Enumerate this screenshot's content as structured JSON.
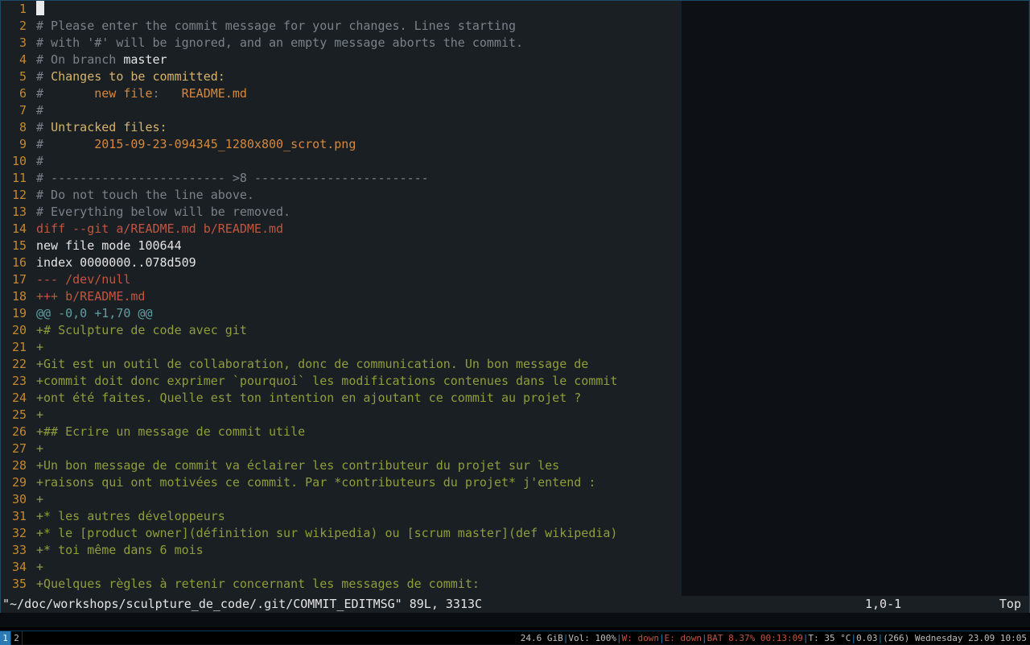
{
  "lines": [
    {
      "n": 1,
      "segs": [
        {
          "cursor": true
        }
      ]
    },
    {
      "n": 2,
      "segs": [
        {
          "t": "# Please enter the commit message for your changes. Lines starting",
          "c": "c-comment"
        }
      ]
    },
    {
      "n": 3,
      "segs": [
        {
          "t": "# with '#' will be ignored, and an empty message aborts the commit.",
          "c": "c-comment"
        }
      ]
    },
    {
      "n": 4,
      "segs": [
        {
          "t": "# On branch ",
          "c": "c-comment"
        },
        {
          "t": "master",
          "c": "c-white"
        }
      ]
    },
    {
      "n": 5,
      "segs": [
        {
          "t": "# ",
          "c": "c-comment"
        },
        {
          "t": "Changes to be committed:",
          "c": "c-yellow"
        }
      ]
    },
    {
      "n": 6,
      "segs": [
        {
          "t": "#       ",
          "c": "c-comment"
        },
        {
          "t": "new file",
          "c": "c-orange"
        },
        {
          "t": ":   ",
          "c": "c-comment"
        },
        {
          "t": "README.md",
          "c": "c-orange"
        }
      ]
    },
    {
      "n": 7,
      "segs": [
        {
          "t": "#",
          "c": "c-comment"
        }
      ]
    },
    {
      "n": 8,
      "segs": [
        {
          "t": "# ",
          "c": "c-comment"
        },
        {
          "t": "Untracked files:",
          "c": "c-yellow"
        }
      ]
    },
    {
      "n": 9,
      "segs": [
        {
          "t": "#       ",
          "c": "c-comment"
        },
        {
          "t": "2015-09-23-094345_1280x800_scrot.png",
          "c": "c-orange"
        }
      ]
    },
    {
      "n": 10,
      "segs": [
        {
          "t": "#",
          "c": "c-comment"
        }
      ]
    },
    {
      "n": 11,
      "segs": [
        {
          "t": "# ------------------------ >8 ------------------------",
          "c": "c-comment"
        }
      ]
    },
    {
      "n": 12,
      "segs": [
        {
          "t": "# Do not touch the line above.",
          "c": "c-comment"
        }
      ]
    },
    {
      "n": 13,
      "segs": [
        {
          "t": "# Everything below will be removed.",
          "c": "c-comment"
        }
      ]
    },
    {
      "n": 14,
      "segs": [
        {
          "t": "diff --git a/README.md b/README.md",
          "c": "c-red"
        }
      ]
    },
    {
      "n": 15,
      "segs": [
        {
          "t": "new file mode 100644",
          "c": "c-white"
        }
      ]
    },
    {
      "n": 16,
      "segs": [
        {
          "t": "index 0000000..078d509",
          "c": "c-white"
        }
      ]
    },
    {
      "n": 17,
      "segs": [
        {
          "t": "--- /dev/null",
          "c": "c-red"
        }
      ]
    },
    {
      "n": 18,
      "segs": [
        {
          "t": "+++ b/README.md",
          "c": "c-red"
        }
      ]
    },
    {
      "n": 19,
      "segs": [
        {
          "t": "@@ -0,0 +1,70 @@",
          "c": "c-cyan"
        }
      ]
    },
    {
      "n": 20,
      "segs": [
        {
          "t": "+# Sculpture de code avec git",
          "c": "c-green"
        }
      ]
    },
    {
      "n": 21,
      "segs": [
        {
          "t": "+",
          "c": "c-green"
        }
      ]
    },
    {
      "n": 22,
      "segs": [
        {
          "t": "+Git est un outil de collaboration, donc de communication. Un bon message de",
          "c": "c-green"
        }
      ]
    },
    {
      "n": 23,
      "segs": [
        {
          "t": "+commit doit donc exprimer `pourquoi` les modifications contenues dans le commit",
          "c": "c-green"
        }
      ]
    },
    {
      "n": 24,
      "segs": [
        {
          "t": "+ont été faites. Quelle est ton intention en ajoutant ce commit au projet ?",
          "c": "c-green"
        }
      ]
    },
    {
      "n": 25,
      "segs": [
        {
          "t": "+",
          "c": "c-green"
        }
      ]
    },
    {
      "n": 26,
      "segs": [
        {
          "t": "+## Ecrire un message de commit utile",
          "c": "c-green"
        }
      ]
    },
    {
      "n": 27,
      "segs": [
        {
          "t": "+",
          "c": "c-green"
        }
      ]
    },
    {
      "n": 28,
      "segs": [
        {
          "t": "+Un bon message de commit va éclairer les contributeur du projet sur les",
          "c": "c-green"
        }
      ]
    },
    {
      "n": 29,
      "segs": [
        {
          "t": "+raisons qui ont motivées ce commit. Par *contributeurs du projet* j'entend :",
          "c": "c-green"
        }
      ]
    },
    {
      "n": 30,
      "segs": [
        {
          "t": "+",
          "c": "c-green"
        }
      ]
    },
    {
      "n": 31,
      "segs": [
        {
          "t": "+* les autres développeurs",
          "c": "c-green"
        }
      ]
    },
    {
      "n": 32,
      "segs": [
        {
          "t": "+* le [product owner](définition sur wikipedia) ou [scrum master](def wikipedia)",
          "c": "c-green"
        }
      ]
    },
    {
      "n": 33,
      "segs": [
        {
          "t": "+* toi même dans 6 mois",
          "c": "c-green"
        }
      ]
    },
    {
      "n": 34,
      "segs": [
        {
          "t": "+",
          "c": "c-green"
        }
      ]
    },
    {
      "n": 35,
      "segs": [
        {
          "t": "+Quelques règles à retenir concernant les messages de commit:",
          "c": "c-green"
        }
      ]
    }
  ],
  "vim_status": {
    "file": "\"~/doc/workshops/sculpture_de_code/.git/COMMIT_EDITMSG\" 89L, 3313C",
    "pos": "1,0-1",
    "scroll": "Top"
  },
  "workspaces": [
    {
      "label": "1",
      "active": true
    },
    {
      "label": "2",
      "active": false
    }
  ],
  "statusbar": {
    "disk": {
      "t": "24.6 GiB",
      "c": "sb-def"
    },
    "vol": {
      "t": "Vol: 100%",
      "c": "sb-def"
    },
    "wlan": {
      "t": "W: down",
      "c": "sb-red"
    },
    "eth": {
      "t": "E: down",
      "c": "sb-red"
    },
    "bat": {
      "t": "BAT 8.37% 00:13:09",
      "c": "sb-red"
    },
    "temp": {
      "t": "T: 35 °C",
      "c": "sb-def"
    },
    "load": {
      "t": "0.03",
      "c": "sb-def"
    },
    "date": {
      "t": "(266) Wednesday 23.09 10:05",
      "c": "sb-def"
    }
  }
}
